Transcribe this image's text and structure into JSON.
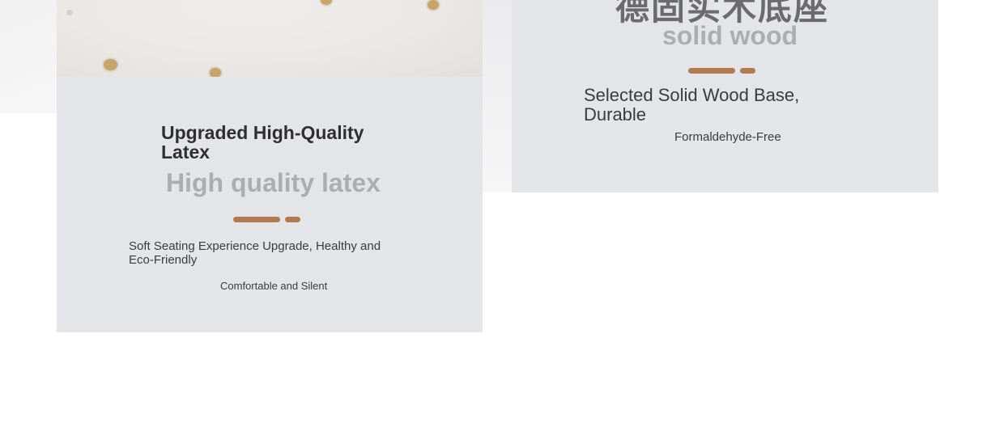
{
  "latex_card": {
    "title": "Upgraded High-Quality Latex",
    "ghost_text": "High quality latex",
    "subtitle": "Soft Seating Experience Upgrade, Healthy and Eco-Friendly",
    "note": "Comfortable and Silent"
  },
  "wood_card": {
    "ghost_text_cn": "德固实木底座",
    "ghost_text": "solid wood",
    "subtitle": "Selected Solid Wood Base, Durable",
    "note": "Formaldehyde-Free"
  },
  "colors": {
    "card_bg": "#e4e5e9",
    "accent": "#b07c4e",
    "ghost": "#acadb1",
    "text": "#2f2f33"
  }
}
